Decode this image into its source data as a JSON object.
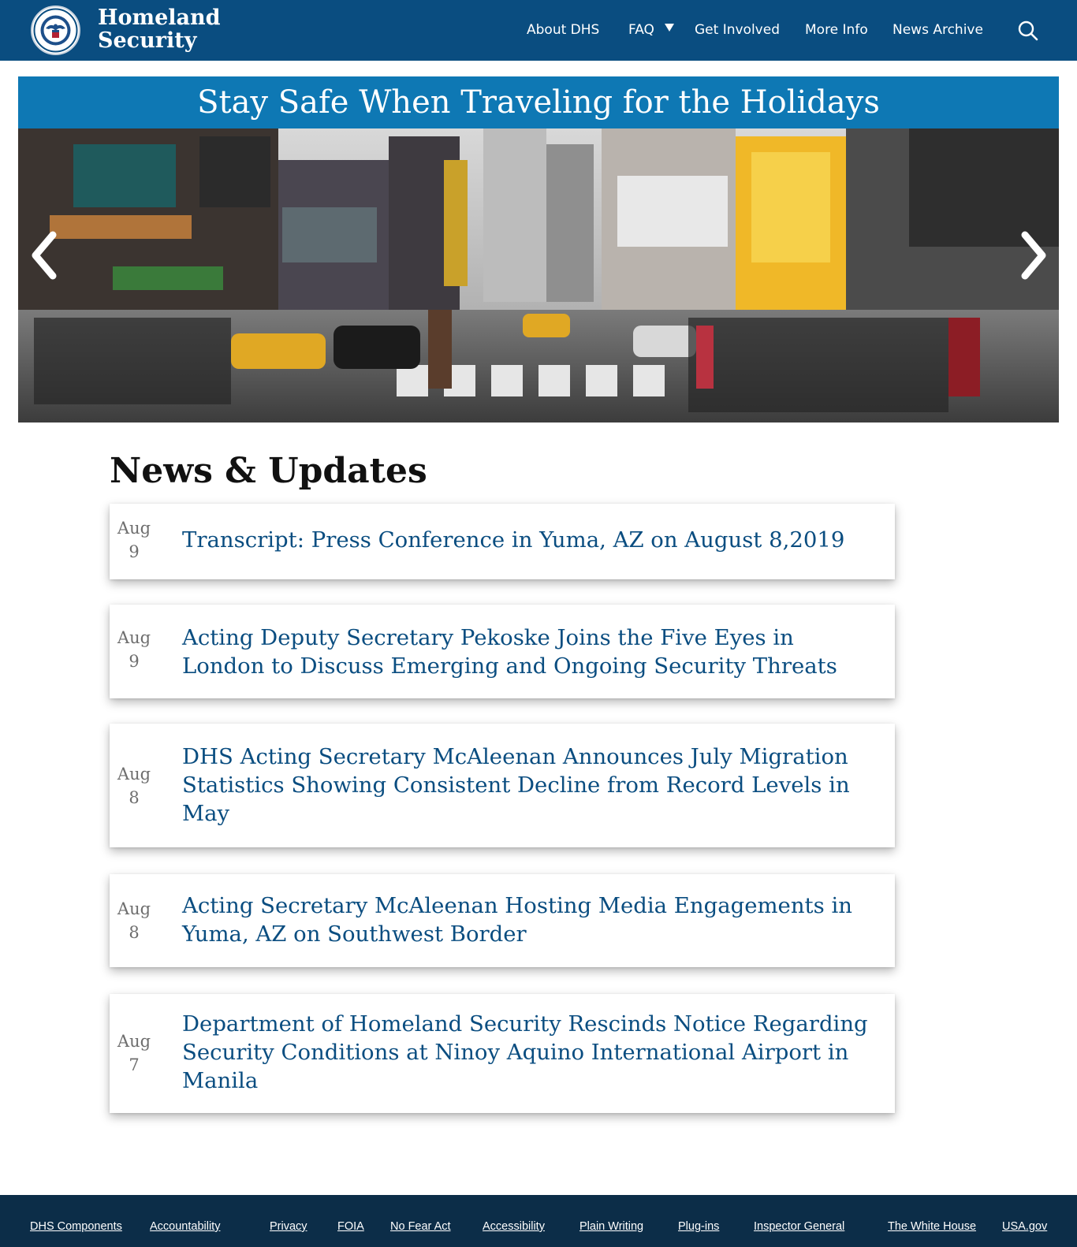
{
  "header": {
    "brand_line1": "Homeland",
    "brand_line2": "Security",
    "nav": [
      {
        "label": "About DHS"
      },
      {
        "label": "FAQ"
      },
      {
        "label": "Get Involved"
      },
      {
        "label": "More Info"
      },
      {
        "label": "News Archive"
      }
    ],
    "search_icon": "search-icon"
  },
  "hero": {
    "title": "Stay Safe When Traveling for the Holidays",
    "prev_icon": "chevron-left-icon",
    "next_icon": "chevron-right-icon"
  },
  "news": {
    "heading": "News & Updates",
    "items": [
      {
        "month": "Aug",
        "day": "9",
        "title": "Transcript: Press Conference in Yuma, AZ on August 8,2019"
      },
      {
        "month": "Aug",
        "day": "9",
        "title": "Acting Deputy Secretary Pekoske Joins the Five Eyes in London to Discuss Emerging and Ongoing Security Threats"
      },
      {
        "month": "Aug",
        "day": "8",
        "title": "DHS Acting Secretary McAleenan Announces July Migration Statistics Showing Consistent Decline from Record Levels in May"
      },
      {
        "month": "Aug",
        "day": "8",
        "title": "Acting Secretary McAleenan Hosting Media Engagements in Yuma, AZ on Southwest Border"
      },
      {
        "month": "Aug",
        "day": "7",
        "title": "Department of Homeland Security Rescinds Notice Regarding Security Conditions at Ninoy Aquino International Airport in Manila"
      }
    ]
  },
  "footer": {
    "links": [
      {
        "label": "DHS Components"
      },
      {
        "label": "Accountability"
      },
      {
        "label": "Privacy"
      },
      {
        "label": "FOIA"
      },
      {
        "label": "No Fear Act"
      },
      {
        "label": "Accessibility"
      },
      {
        "label": "Plain Writing"
      },
      {
        "label": "Plug-ins"
      },
      {
        "label": "Inspector General"
      },
      {
        "label": "The White House"
      },
      {
        "label": "USA.gov"
      }
    ]
  },
  "colors": {
    "header_bg": "#0a4d80",
    "hero_bar": "#0e78b4",
    "link": "#0a4d80",
    "footer_bg": "#0c2d48"
  }
}
